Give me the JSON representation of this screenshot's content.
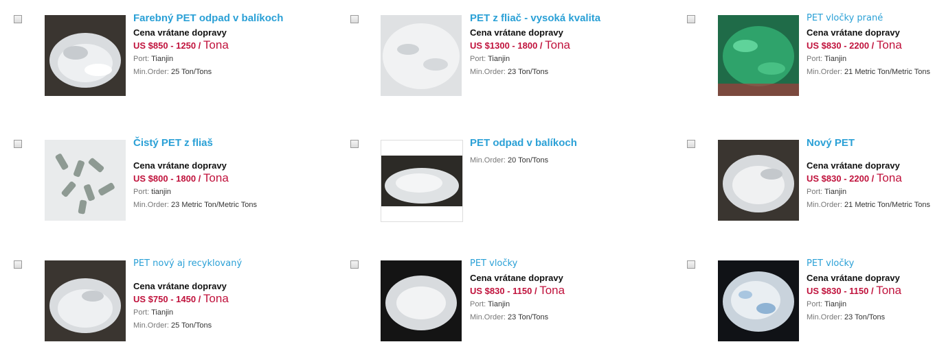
{
  "products": [
    {
      "title": "Farebný PET odpad v balíkoch",
      "title_light": false,
      "price_note": "Cena vrátane dopravy",
      "price": "US $850 - 1250 / ",
      "unit": "Tona",
      "port_label": "Port:",
      "port": "Tianjin",
      "min_label": "Min.Order:",
      "min": "25 Ton/Tons",
      "photo": "white-flakes-dark"
    },
    {
      "title": "PET z fliač - vysoká kvalita",
      "title_light": false,
      "price_note": "Cena vrátane dopravy",
      "price": "US $1300 - 1800 / ",
      "unit": "Tona",
      "port_label": "Port:",
      "port": "Tianjin",
      "min_label": "Min.Order:",
      "min": "23 Ton/Tons",
      "photo": "white-flakes-light"
    },
    {
      "title": "PET vločky prané",
      "title_light": true,
      "price_note": "Cena vrátane dopravy",
      "price": "US $830 - 2200 / ",
      "unit": "Tona",
      "port_label": "Port:",
      "port": "Tianjin",
      "min_label": "Min.Order:",
      "min": "21 Metric Ton/Metric Tons",
      "photo": "green-flakes"
    },
    {
      "title": "Čistý PET z fliaš",
      "title_light": false,
      "price_note": "Cena vrátane dopravy",
      "price": "US $800 - 1800 / ",
      "unit": "Tona",
      "port_label": "Port:",
      "port": "tianjin",
      "min_label": "Min.Order:",
      "min": "23 Metric Ton/Metric Tons",
      "photo": "grey-pellets"
    },
    {
      "title": "PET odpad v balíkoch",
      "title_light": false,
      "price_note": "",
      "price": "",
      "unit": "",
      "port_label": "",
      "port": "",
      "min_label": "Min.Order:",
      "min": "20 Ton/Tons",
      "photo": "white-pile"
    },
    {
      "title": "Nový PET",
      "title_light": false,
      "price_note": "Cena vrátane dopravy",
      "price": "US $830 - 2200 / ",
      "unit": "Tona",
      "port_label": "Port:",
      "port": "Tianjin",
      "min_label": "Min.Order:",
      "min": "21 Metric Ton/Metric Tons",
      "photo": "white-flakes-dark"
    },
    {
      "title": "PET nový aj recyklovaný",
      "title_light": true,
      "price_note": "Cena vrátane dopravy",
      "price": "US $750 - 1450 / ",
      "unit": "Tona",
      "port_label": "Port:",
      "port": "Tianjin",
      "min_label": "Min.Order:",
      "min": "25 Ton/Tons",
      "photo": "white-flakes-dark"
    },
    {
      "title": "PET vločky",
      "title_light": true,
      "price_note": "Cena vrátane dopravy",
      "price": "US $830 - 1150 / ",
      "unit": "Tona",
      "port_label": "Port:",
      "port": "Tianjin",
      "min_label": "Min.Order:",
      "min": "23 Ton/Tons",
      "photo": "white-flakes-black"
    },
    {
      "title": "PET vločky",
      "title_light": true,
      "price_note": "Cena vrátane dopravy",
      "price": "US $830 - 1150 / ",
      "unit": "Tona",
      "port_label": "Port:",
      "port": "Tianjin",
      "min_label": "Min.Order:",
      "min": "23 Ton/Tons",
      "photo": "blue-white-flakes"
    }
  ],
  "colors": {
    "title": "#2aa0d6",
    "price": "#c0123c"
  }
}
